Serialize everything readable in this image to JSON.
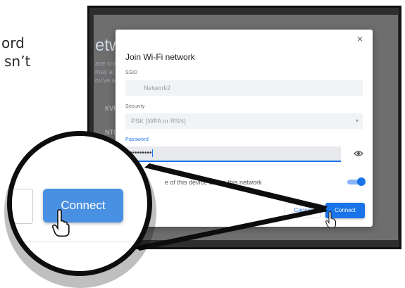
{
  "background_text": {
    "line1": "ord",
    "line2": "sn’t"
  },
  "behind_dialog": {
    "title_fragment": "etw",
    "line1": "ase con",
    "line2": "may al",
    "line3": "ou've alr",
    "row1": "KVP",
    "row2": "NTC"
  },
  "dialog": {
    "close_glyph": "×",
    "title": "Join Wi-Fi network",
    "ssid_label": "SSID",
    "ssid_value": "Network2",
    "security_label": "Security",
    "security_value": "PSK (WPA or RSN)",
    "security_chevron": "▾",
    "password_label": "Password",
    "password_value": "•••••••••",
    "share_text": "e of this device to use this network",
    "share_enabled": true,
    "cancel_label": "Cancel",
    "connect_label": "Connect"
  },
  "magnifier": {
    "connect_label": "Connect"
  },
  "icons": {
    "close": "close-icon",
    "eye": "eye-icon",
    "cursor": "hand-pointer-icon",
    "dropdown": "chevron-down-icon"
  },
  "colors": {
    "accent": "#1a73e8",
    "magnified_button": "#4a90e2",
    "frame": "#2e2e2e"
  }
}
